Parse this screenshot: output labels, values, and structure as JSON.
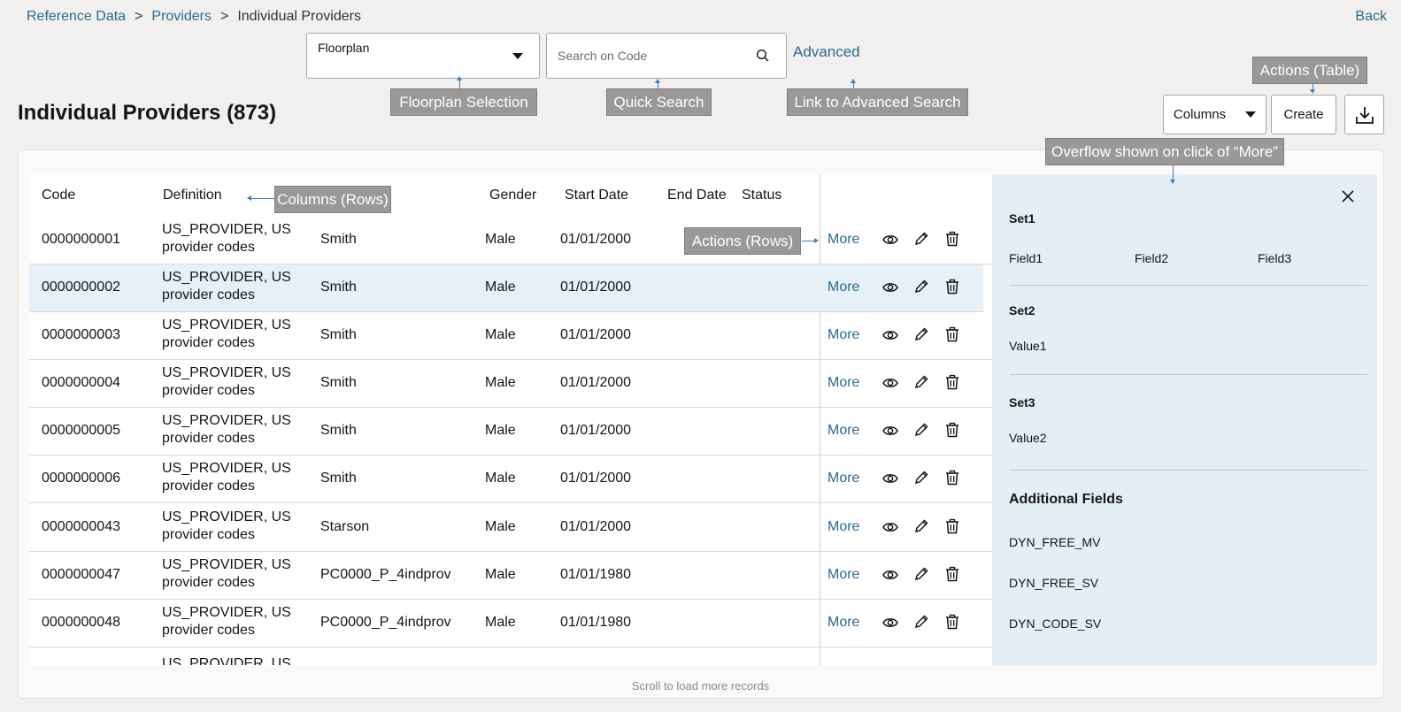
{
  "breadcrumb": {
    "items": [
      "Reference Data",
      "Providers"
    ],
    "current": "Individual Providers",
    "separator": ">"
  },
  "header": {
    "back": "Back",
    "title": "Individual Providers (873)"
  },
  "floorplan": {
    "value": "Floorplan"
  },
  "search": {
    "placeholder": "Search on Code",
    "advanced": "Advanced"
  },
  "toolbar": {
    "columns": "Columns",
    "create": "Create"
  },
  "annotations": {
    "floorplan": "Floorplan Selection",
    "quick_search": "Quick Search",
    "advanced_search": "Link to Advanced Search",
    "actions_table": "Actions (Table)",
    "overflow": "Overflow shown on click of “More”",
    "columns_rows": "Columns (Rows)",
    "actions_rows": "Actions (Rows)"
  },
  "table": {
    "headers": [
      "Code",
      "Definition",
      "Gender",
      "Start Date",
      "End Date",
      "Status"
    ],
    "more_label": "More",
    "rows": [
      {
        "code": "0000000001",
        "def1": "US_PROVIDER, US",
        "def2": "provider codes",
        "name": "Smith",
        "gender": "Male",
        "start": "01/01/2000"
      },
      {
        "code": "0000000002",
        "def1": "US_PROVIDER, US",
        "def2": "provider codes",
        "name": "Smith",
        "gender": "Male",
        "start": "01/01/2000"
      },
      {
        "code": "0000000003",
        "def1": "US_PROVIDER, US",
        "def2": "provider codes",
        "name": "Smith",
        "gender": "Male",
        "start": "01/01/2000"
      },
      {
        "code": "0000000004",
        "def1": "US_PROVIDER, US",
        "def2": "provider codes",
        "name": "Smith",
        "gender": "Male",
        "start": "01/01/2000"
      },
      {
        "code": "0000000005",
        "def1": "US_PROVIDER, US",
        "def2": "provider codes",
        "name": "Smith",
        "gender": "Male",
        "start": "01/01/2000"
      },
      {
        "code": "0000000006",
        "def1": "US_PROVIDER, US",
        "def2": "provider codes",
        "name": "Smith",
        "gender": "Male",
        "start": "01/01/2000"
      },
      {
        "code": "0000000043",
        "def1": "US_PROVIDER, US",
        "def2": "provider codes",
        "name": "Starson",
        "gender": "Male",
        "start": "01/01/2000"
      },
      {
        "code": "0000000047",
        "def1": "US_PROVIDER, US",
        "def2": "provider codes",
        "name": "PC0000_P_4indprov",
        "gender": "Male",
        "start": "01/01/1980"
      },
      {
        "code": "0000000048",
        "def1": "US_PROVIDER, US",
        "def2": "provider codes",
        "name": "PC0000_P_4indprov",
        "gender": "Male",
        "start": "01/01/1980"
      }
    ],
    "partial_row": "US_PROVIDER, US",
    "scroll_hint": "Scroll to load more records"
  },
  "overflow_panel": {
    "set1": "Set1",
    "field1": "Field1",
    "field2": "Field2",
    "field3": "Field3",
    "set2": "Set2",
    "value1": "Value1",
    "set3": "Set3",
    "value2": "Value2",
    "additional": "Additional Fields",
    "dyn": [
      "DYN_FREE_MV",
      "DYN_FREE_SV",
      "DYN_CODE_SV"
    ]
  }
}
